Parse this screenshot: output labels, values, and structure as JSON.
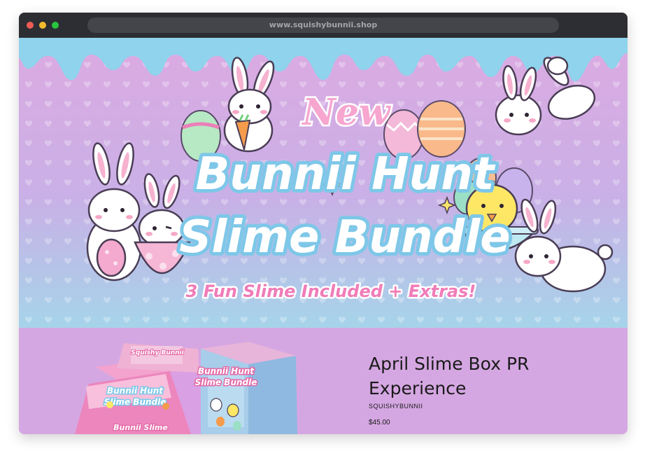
{
  "browser": {
    "url": "www.squishybunnii.shop",
    "traffic_lights": [
      "close",
      "minimize",
      "maximize"
    ]
  },
  "hero": {
    "tag": "New",
    "title_line1": "Bunnii Hunt",
    "title_line2": "Slime Bundle",
    "subtitle": "3 Fun Slime Included + Extras!"
  },
  "product": {
    "title": "April Slime Box PR Experience",
    "vendor": "SQUISHYBUNNII",
    "price": "$45.00",
    "box_front_title_line1": "Bunnii Hunt",
    "box_front_title_line2": "Slime Bundle",
    "box_open_label_line1": "Squishy Bunnii",
    "box_open_label_line2": "Bunnii Hunt",
    "box_open_label_line3": "Slime Bundle",
    "box_inner_label": "Bunnii Slime"
  },
  "colors": {
    "titlebar": "#2d2e33",
    "drip": "#8fd3ec",
    "hero_top": "#d9a4de",
    "hero_bottom": "#9fd0ea",
    "title_fill": "#ffffff",
    "title_outline": "#7fc8e8",
    "tag_pink": "#f07cb8",
    "product_bg": "#d5a7e2"
  }
}
